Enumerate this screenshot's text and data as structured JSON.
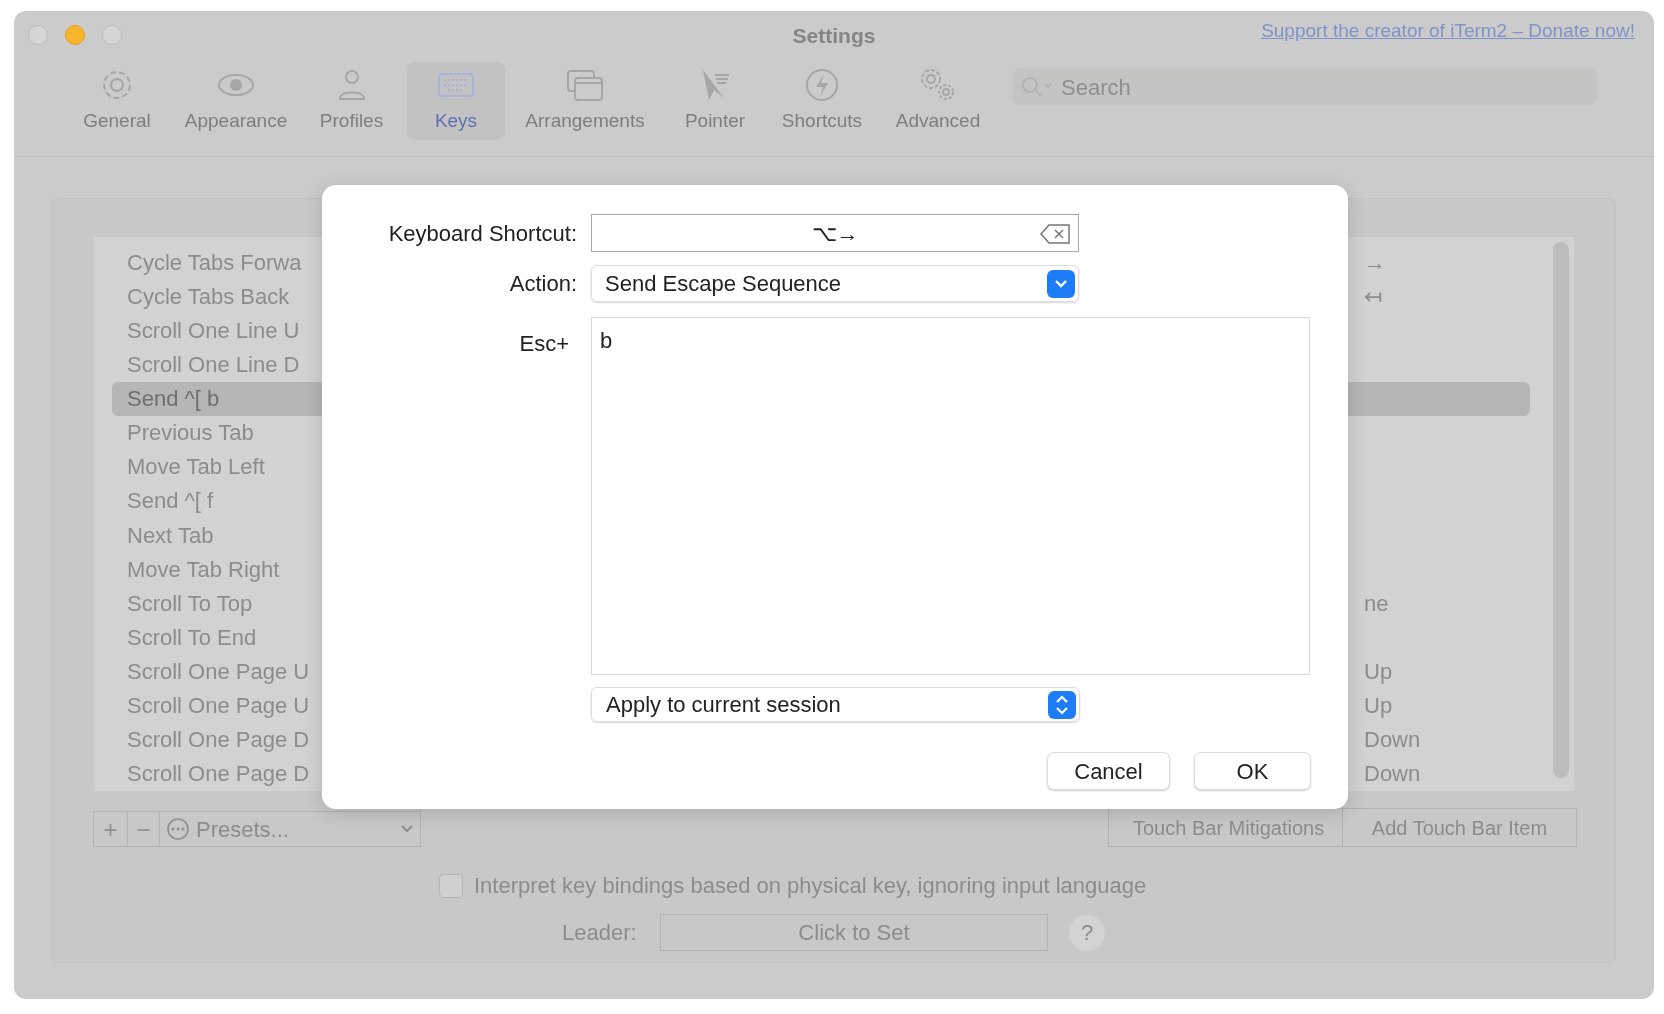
{
  "window": {
    "title": "Settings",
    "donate_link": "Support the creator of iTerm2 – Donate now!"
  },
  "toolbar": [
    {
      "label": "General",
      "selected": false
    },
    {
      "label": "Appearance",
      "selected": false
    },
    {
      "label": "Profiles",
      "selected": false
    },
    {
      "label": "Keys",
      "selected": true
    },
    {
      "label": "Arrangements",
      "selected": false
    },
    {
      "label": "Pointer",
      "selected": false
    },
    {
      "label": "Shortcuts",
      "selected": false
    },
    {
      "label": "Advanced",
      "selected": false
    }
  ],
  "search": {
    "placeholder": "Search"
  },
  "bindings": [
    {
      "action": "Cycle Tabs Forwa",
      "shortcut": "→",
      "selected": false
    },
    {
      "action": "Cycle Tabs Back",
      "shortcut": "↤",
      "selected": false
    },
    {
      "action": "Scroll One Line U",
      "selected": false
    },
    {
      "action": "Scroll One Line D",
      "selected": false
    },
    {
      "action": "Send ^[ b",
      "selected": true
    },
    {
      "action": "Previous Tab",
      "selected": false
    },
    {
      "action": "Move Tab Left",
      "selected": false
    },
    {
      "action": "Send ^[ f",
      "selected": false
    },
    {
      "action": "Next Tab",
      "selected": false
    },
    {
      "action": "Move Tab Right",
      "selected": false
    },
    {
      "action": "Scroll To Top",
      "shortcut": "ne",
      "selected": false
    },
    {
      "action": "Scroll To End",
      "selected": false
    },
    {
      "action": "Scroll One Page U",
      "shortcut": "Up",
      "selected": false
    },
    {
      "action": "Scroll One Page U",
      "shortcut": "Up",
      "selected": false
    },
    {
      "action": "Scroll One Page D",
      "shortcut": "Down",
      "selected": false
    },
    {
      "action": "Scroll One Page D",
      "shortcut": "Down",
      "selected": false
    }
  ],
  "list_buttons": [
    "+",
    "−"
  ],
  "presets": {
    "label": "Presets..."
  },
  "touch_bar_buttons": [
    "Touch Bar Mitigations",
    "Add Touch Bar Item"
  ],
  "physical_key_option": {
    "label": "Interpret key bindings based on physical key, ignoring input language",
    "checked": false
  },
  "leader": {
    "label": "Leader:",
    "button": "Click to Set",
    "help": "?"
  },
  "dialog": {
    "shortcut_label": "Keyboard Shortcut:",
    "shortcut": "⌥→",
    "action_label": "Action:",
    "action": "Send Escape Sequence",
    "esc_label": "Esc+",
    "esc_value": "b",
    "scope": "Apply to current session",
    "buttons": [
      "Cancel",
      "OK"
    ]
  }
}
